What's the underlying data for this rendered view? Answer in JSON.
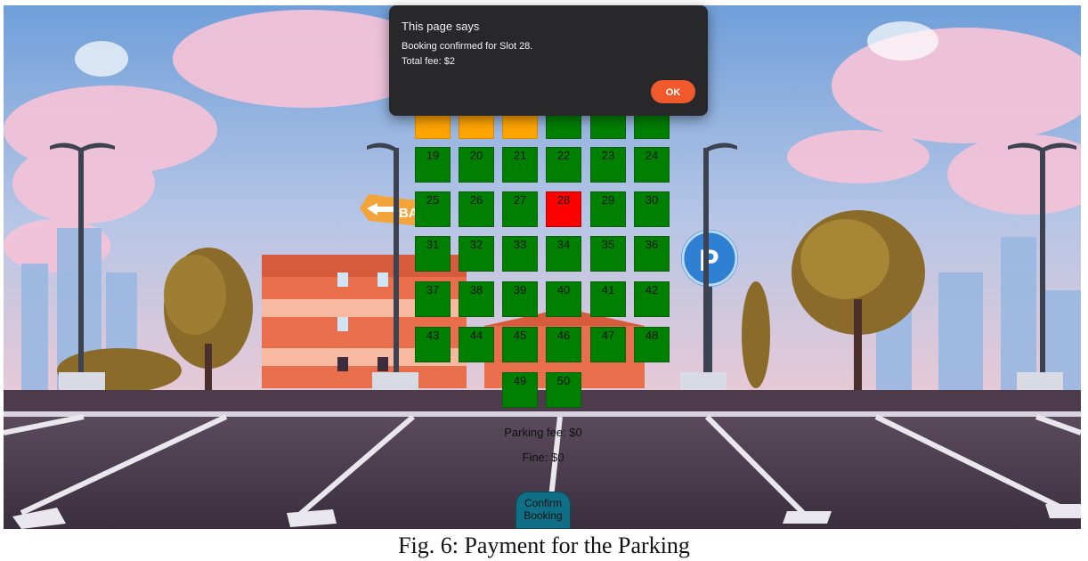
{
  "dialog": {
    "title": "This page says",
    "message_line1": "Booking confirmed for Slot 28.",
    "message_line2": "Total fee: $2",
    "ok_label": "OK"
  },
  "slots": [
    {
      "label": "",
      "status": "reserved"
    },
    {
      "label": "",
      "status": "reserved"
    },
    {
      "label": "",
      "status": "reserved"
    },
    {
      "label": "",
      "status": "available"
    },
    {
      "label": "",
      "status": "available"
    },
    {
      "label": "",
      "status": "available"
    },
    {
      "label": "19",
      "status": "available"
    },
    {
      "label": "20",
      "status": "available"
    },
    {
      "label": "21",
      "status": "available"
    },
    {
      "label": "22",
      "status": "available"
    },
    {
      "label": "23",
      "status": "available"
    },
    {
      "label": "24",
      "status": "available"
    },
    {
      "label": "25",
      "status": "available"
    },
    {
      "label": "26",
      "status": "available"
    },
    {
      "label": "27",
      "status": "available"
    },
    {
      "label": "28",
      "status": "selected"
    },
    {
      "label": "29",
      "status": "available"
    },
    {
      "label": "30",
      "status": "available"
    },
    {
      "label": "31",
      "status": "available"
    },
    {
      "label": "32",
      "status": "available"
    },
    {
      "label": "33",
      "status": "available"
    },
    {
      "label": "34",
      "status": "available"
    },
    {
      "label": "35",
      "status": "available"
    },
    {
      "label": "36",
      "status": "available"
    },
    {
      "label": "37",
      "status": "available"
    },
    {
      "label": "38",
      "status": "available"
    },
    {
      "label": "39",
      "status": "available"
    },
    {
      "label": "40",
      "status": "available"
    },
    {
      "label": "41",
      "status": "available"
    },
    {
      "label": "42",
      "status": "available"
    },
    {
      "label": "43",
      "status": "available"
    },
    {
      "label": "44",
      "status": "available"
    },
    {
      "label": "45",
      "status": "available"
    },
    {
      "label": "46",
      "status": "available"
    },
    {
      "label": "47",
      "status": "available"
    },
    {
      "label": "48",
      "status": "available"
    },
    {
      "label": "49",
      "status": "available"
    },
    {
      "label": "50",
      "status": "available"
    }
  ],
  "fees": {
    "parking_fee": "Parking fee: $0",
    "fine": "Fine: $0"
  },
  "confirm_button": {
    "line1": "Confirm",
    "line2": "Booking"
  },
  "background_sign": "BA",
  "caption": "Fig. 6: Payment for the Parking",
  "colors": {
    "available": "#008000",
    "selected": "#ff0000",
    "reserved": "#ffa500",
    "ok_button": "#f0592b",
    "dialog_bg": "#28282b",
    "confirm_button": "#0f6f86"
  }
}
